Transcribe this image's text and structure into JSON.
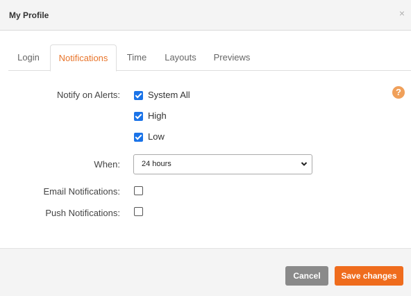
{
  "dialog": {
    "title": "My Profile",
    "close_glyph": "×"
  },
  "tabs": [
    {
      "label": "Login",
      "active": false
    },
    {
      "label": "Notifications",
      "active": true
    },
    {
      "label": "Time",
      "active": false
    },
    {
      "label": "Layouts",
      "active": false
    },
    {
      "label": "Previews",
      "active": false
    }
  ],
  "help": {
    "glyph": "?",
    "icon": "help-icon",
    "color": "#f0a05a"
  },
  "form": {
    "notify_label": "Notify on Alerts:",
    "alerts": [
      {
        "label": "System All",
        "checked": true
      },
      {
        "label": "High",
        "checked": true
      },
      {
        "label": "Low",
        "checked": true
      }
    ],
    "when_label": "When:",
    "when_value": "24 hours",
    "email_label": "Email Notifications:",
    "email_checked": false,
    "push_label": "Push Notifications:",
    "push_checked": false
  },
  "footer": {
    "cancel_label": "Cancel",
    "save_label": "Save changes"
  },
  "colors": {
    "accent": "#e8742a",
    "save": "#ef6c1d",
    "cancel": "#8a8a8a",
    "checkbox": "#1a73e8"
  }
}
